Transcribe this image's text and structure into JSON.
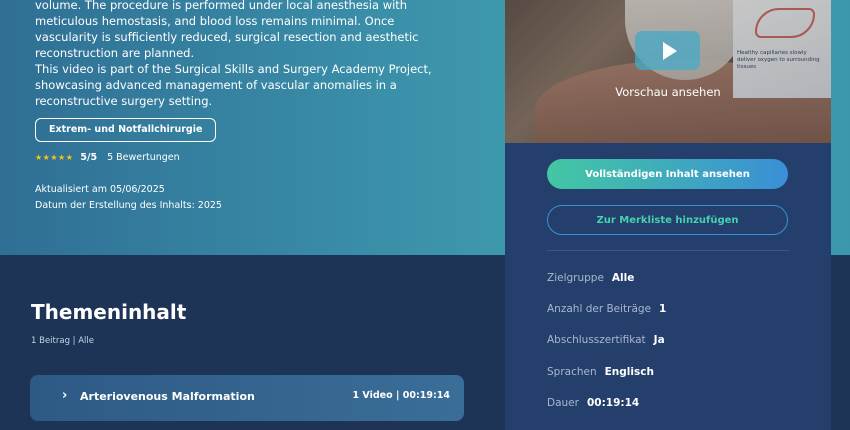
{
  "description": {
    "lines": [
      "volume. The procedure is performed under local anesthesia with",
      "meticulous hemostasis, and blood loss remains minimal. Once",
      "vascularity is sufficiently reduced, surgical resection and aesthetic",
      "reconstruction are planned.",
      "This video is part of the Surgical Skills and Surgery Academy Project,",
      "showcasing advanced management of vascular anomalies in a",
      "reconstructive surgery setting."
    ]
  },
  "tag": "Extrem- und Notfallchirurgie",
  "rating": {
    "stars": "★★★★★",
    "score": "5/5",
    "count": "5 Bewertungen",
    "value": 5,
    "max": 5
  },
  "updated": "Aktualisiert am 05/06/2025",
  "created": "Datum der Erstellung des Inhalts: 2025",
  "section": {
    "title": "Themeninhalt",
    "meta": "1 Beitrag | Alle"
  },
  "accordion": {
    "chevron": "›",
    "title": "Arteriovenous Malformation",
    "meta": "1 Video | 00:19:14"
  },
  "card": {
    "preview_label": "Vorschau ansehen",
    "monitor_text": "Healthy capillaries slowly deliver oxygen to surrounding tissues",
    "primary_button": "Vollständigen Inhalt ansehen",
    "secondary_button": "Zur Merkliste hinzufügen",
    "info": [
      {
        "label": "Zielgruppe",
        "value": "Alle"
      },
      {
        "label": "Anzahl der Beiträge",
        "value": "1"
      },
      {
        "label": "Abschlusszertifikat",
        "value": "Ja"
      },
      {
        "label": "Sprachen",
        "value": "Englisch"
      },
      {
        "label": "Dauer",
        "value": "00:19:14"
      }
    ]
  },
  "colors": {
    "accent_green": "#44c7a3",
    "accent_blue": "#3a8fd6",
    "panel": "#243f6b",
    "background": "#1e3457",
    "star": "#f5c518"
  }
}
